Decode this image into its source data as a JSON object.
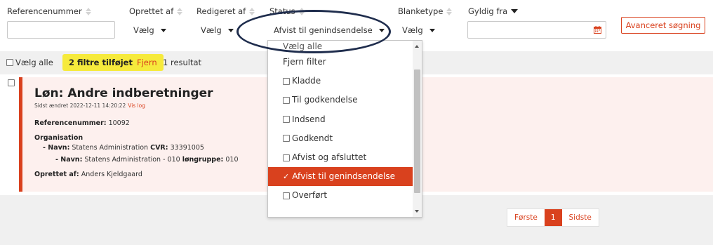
{
  "columns": {
    "reference": "Referencenummer",
    "created_by": "Oprettet af",
    "edited_by": "Redigeret af",
    "status": "Status",
    "form_type": "Blanketype",
    "valid_from": "Gyldig fra"
  },
  "filters": {
    "created_by_value": "Vælg",
    "edited_by_value": "Vælg",
    "status_value": "Afvist til genindsendelse",
    "form_type_value": "Vælg",
    "reference_value": "",
    "valid_from_value": ""
  },
  "advanced_search_label": "Avanceret søgning",
  "toolbar": {
    "select_all_label": "Vælg alle",
    "filters_added": "2 filtre tilføjet",
    "remove_label": "Fjern",
    "result_count": "1 resultat"
  },
  "result": {
    "title": "Løn: Andre indberetninger",
    "last_changed": "Sidst ændret 2022-12-11 14:20:22",
    "log_link": "Vis log",
    "reference_label": "Referencenummer:",
    "reference_value": "10092",
    "organisation_label": "Organisation",
    "org_line1_name_label": "- Navn:",
    "org_line1_name": "Statens Administration",
    "org_line1_cvr_label": "CVR:",
    "org_line1_cvr": "33391005",
    "org_line2_name_label": "- Navn:",
    "org_line2_name": "Statens Administration - 010",
    "org_line2_group_label": "løngruppe:",
    "org_line2_group": "010",
    "created_by_label": "Oprettet af:",
    "created_by_value": "Anders Kjeldgaard"
  },
  "pagination": {
    "first": "Første",
    "current": "1",
    "last": "Sidste"
  },
  "status_dropdown": {
    "select_all": "Vælg alle",
    "clear_filter": "Fjern filter",
    "options": [
      {
        "label": "Kladde",
        "checked": false
      },
      {
        "label": "Til godkendelse",
        "checked": false
      },
      {
        "label": "Indsend",
        "checked": false
      },
      {
        "label": "Godkendt",
        "checked": false
      },
      {
        "label": "Afvist og afsluttet",
        "checked": false
      },
      {
        "label": "Afvist til genindsendelse",
        "checked": true
      },
      {
        "label": "Overført",
        "checked": false
      }
    ]
  },
  "colors": {
    "accent": "#d9411e",
    "highlight": "#f6ea3c",
    "card_background": "#fdf0ee",
    "annotation": "#1f2d4d"
  }
}
